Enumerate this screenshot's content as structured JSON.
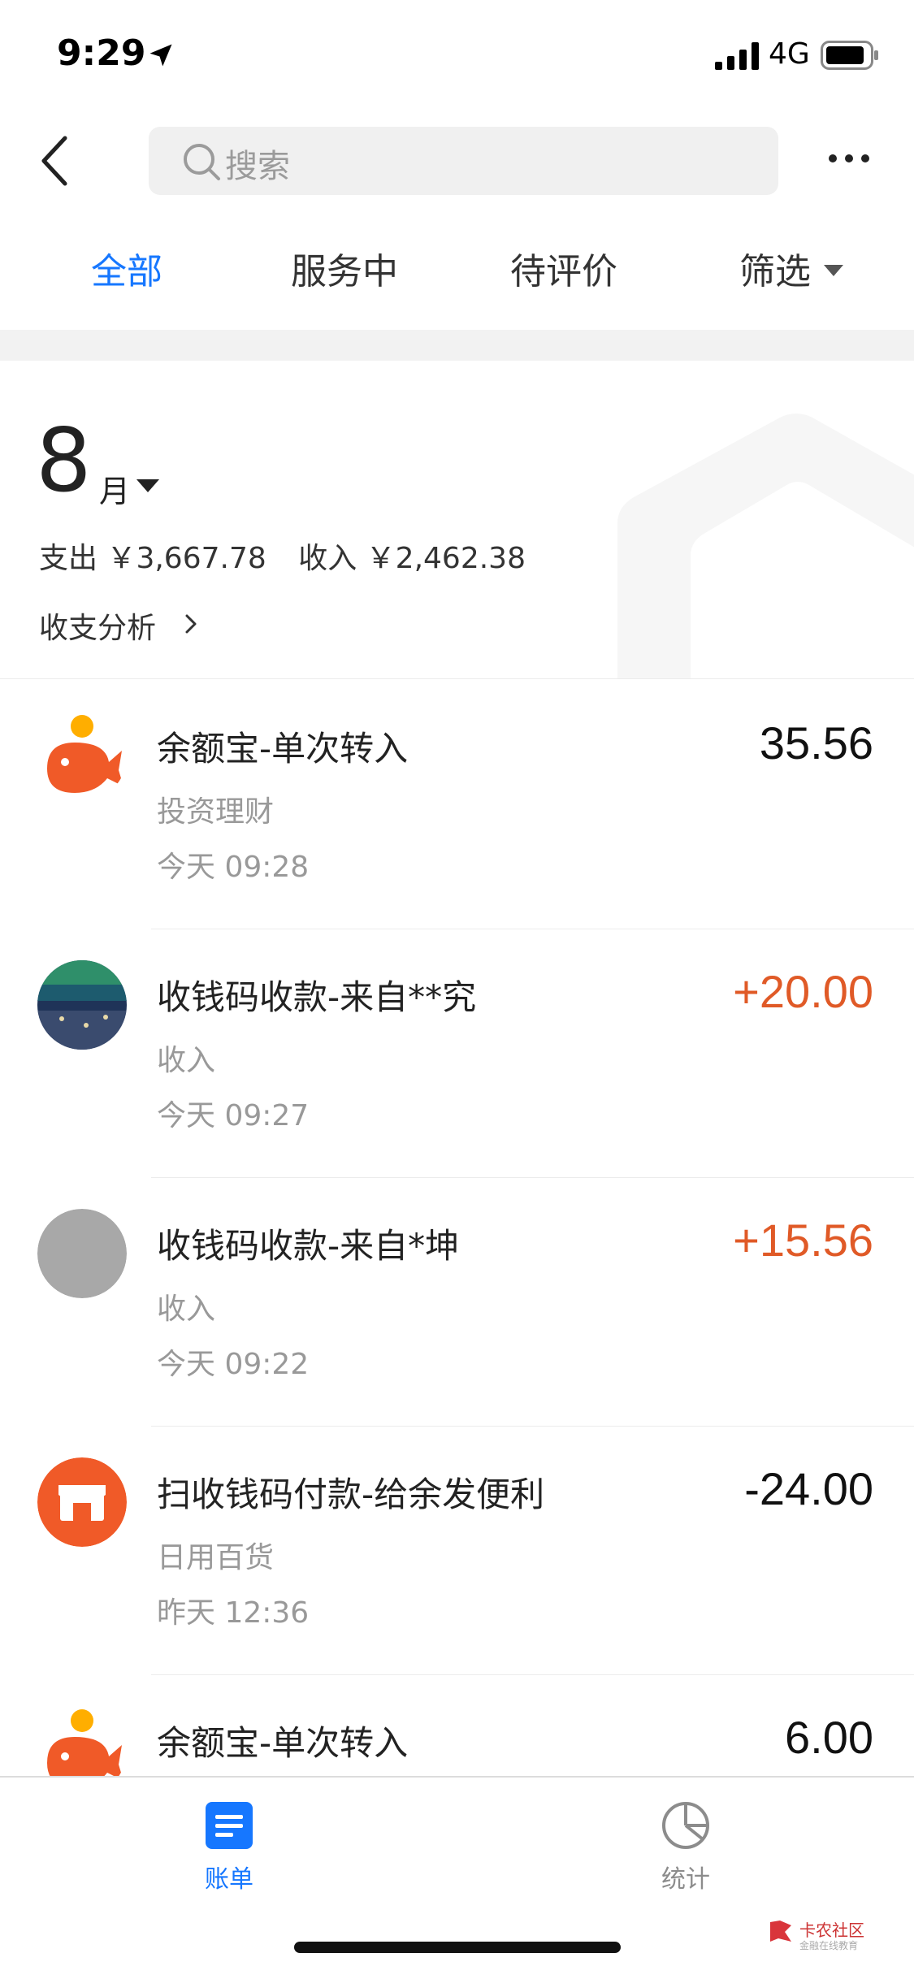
{
  "status": {
    "time": "9:29",
    "network": "4G"
  },
  "search": {
    "placeholder": "搜索"
  },
  "tabs": [
    {
      "label": "全部",
      "active": true
    },
    {
      "label": "服务中",
      "active": false
    },
    {
      "label": "待评价",
      "active": false
    },
    {
      "label": "筛选",
      "active": false
    }
  ],
  "summary": {
    "month": "8",
    "month_unit": "月",
    "expense": "支出 ￥3,667.78",
    "income": "收入 ￥2,462.38",
    "analysis": "收支分析"
  },
  "transactions": [
    {
      "title": "余额宝-单次转入",
      "category": "投资理财",
      "time": "今天  09:28",
      "amount": "35.56",
      "icon": "yuebao-icon"
    },
    {
      "title": "收钱码收款-来自**究",
      "category": "收入",
      "time": "今天  09:27",
      "amount": "+20.00",
      "icon": "landscape-avatar"
    },
    {
      "title": "收钱码收款-来自*坤",
      "category": "收入",
      "time": "今天  09:22",
      "amount": "+15.56",
      "icon": "gray-avatar"
    },
    {
      "title": "扫收钱码付款-给余发便利",
      "category": "日用百货",
      "time": "昨天  12:36",
      "amount": "-24.00",
      "icon": "store-icon"
    },
    {
      "title": "余额宝-单次转入",
      "category": "",
      "time": "",
      "amount": "6.00",
      "icon": "yuebao-icon"
    }
  ],
  "nav": {
    "bill_label": "账单",
    "stats_label": "统计"
  },
  "watermark": {
    "text": "卡农社区",
    "sub": "金融在线教育"
  },
  "colors": {
    "accent": "#1677ff",
    "income": "#e05a27",
    "brand_orange": "#f05a28"
  }
}
